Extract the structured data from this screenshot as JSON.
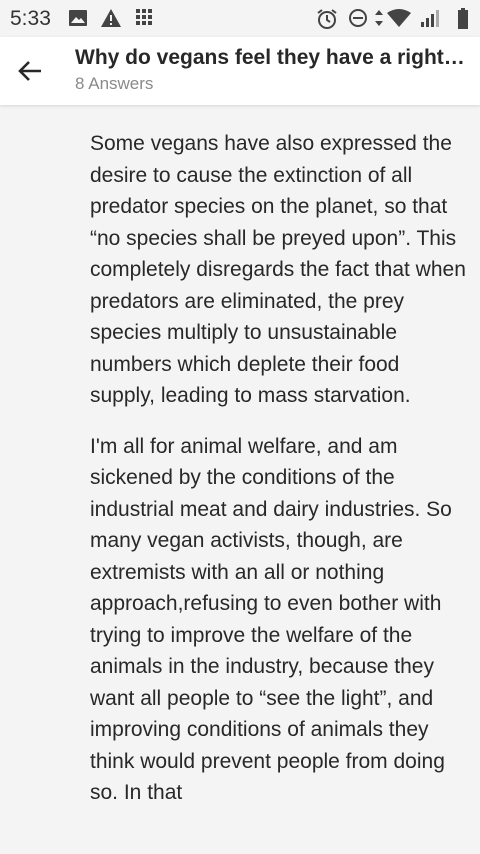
{
  "status_bar": {
    "time": "5:33"
  },
  "header": {
    "title": "Why do vegans feel they have a right to tell people how to live their lives and what to eat?",
    "subtitle": "8 Answers"
  },
  "answer": {
    "paragraphs": [
      "Some vegans have also expressed the desire to cause the extinction of all predator species on the planet, so that “no species shall be preyed upon”. This completely disregards the fact that when predators are eliminated, the prey species multiply to unsustainable numbers which deplete their food supply, leading to mass starvation.",
      "I'm all for animal welfare, and am sickened by the conditions of the industrial meat and dairy industries. So many vegan activists, though, are extremists with an all or nothing approach,refusing to even bother with trying to improve the welfare of the animals in the industry, because they want all people to “see the light”, and improving conditions of animals they think would prevent people from doing so. In that"
    ]
  },
  "colors": {
    "background": "#f4f4f4",
    "header_bg": "#ffffff",
    "text": "#282828",
    "muted": "#8a8a8a"
  }
}
